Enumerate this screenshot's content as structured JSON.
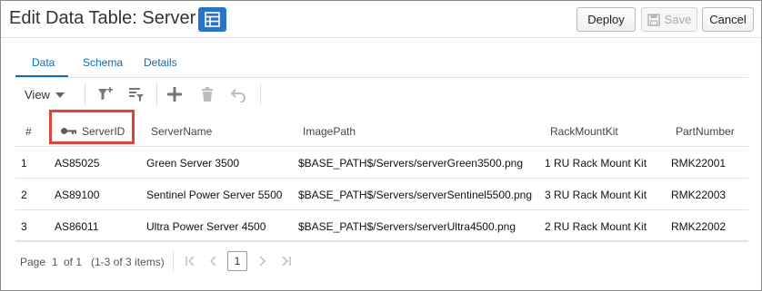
{
  "header": {
    "title": "Edit Data Table: Server",
    "table_icon": "table-icon",
    "deploy_label": "Deploy",
    "save_label": "Save",
    "cancel_label": "Cancel",
    "accent_color": "#2a73c5"
  },
  "tabs": [
    {
      "label": "Data",
      "selected": true
    },
    {
      "label": "Schema",
      "selected": false
    },
    {
      "label": "Details",
      "selected": false
    }
  ],
  "toolbar": {
    "view_label": "View",
    "icons": [
      "add-filter-icon",
      "filter-settings-icon",
      "add-row-icon",
      "delete-icon",
      "undo-icon"
    ]
  },
  "table": {
    "columns": [
      "#",
      "ServerID",
      "ServerName",
      "ImagePath",
      "RackMountKit",
      "PartNumber"
    ],
    "key_column": "ServerID",
    "rows": [
      [
        "1",
        "AS85025",
        "Green Server 3500",
        "$BASE_PATH$/Servers/serverGreen3500.png",
        "1 RU Rack Mount Kit",
        "RMK22001"
      ],
      [
        "2",
        "AS89100",
        "Sentinel Power Server 5500",
        "$BASE_PATH$/Servers/serverSentinel5500.png",
        "3 RU Rack Mount Kit",
        "RMK22003"
      ],
      [
        "3",
        "AS86011",
        "Ultra Power Server 4500",
        "$BASE_PATH$/Servers/serverUltra4500.png",
        "2 RU Rack Mount Kit",
        "RMK22002"
      ]
    ]
  },
  "pagination": {
    "page_label": "Page",
    "current_page": "1",
    "of_label": "of 1",
    "items_label": "(1-3 of 3 items)",
    "page_input": "1"
  },
  "highlight_color": "#e0413b"
}
